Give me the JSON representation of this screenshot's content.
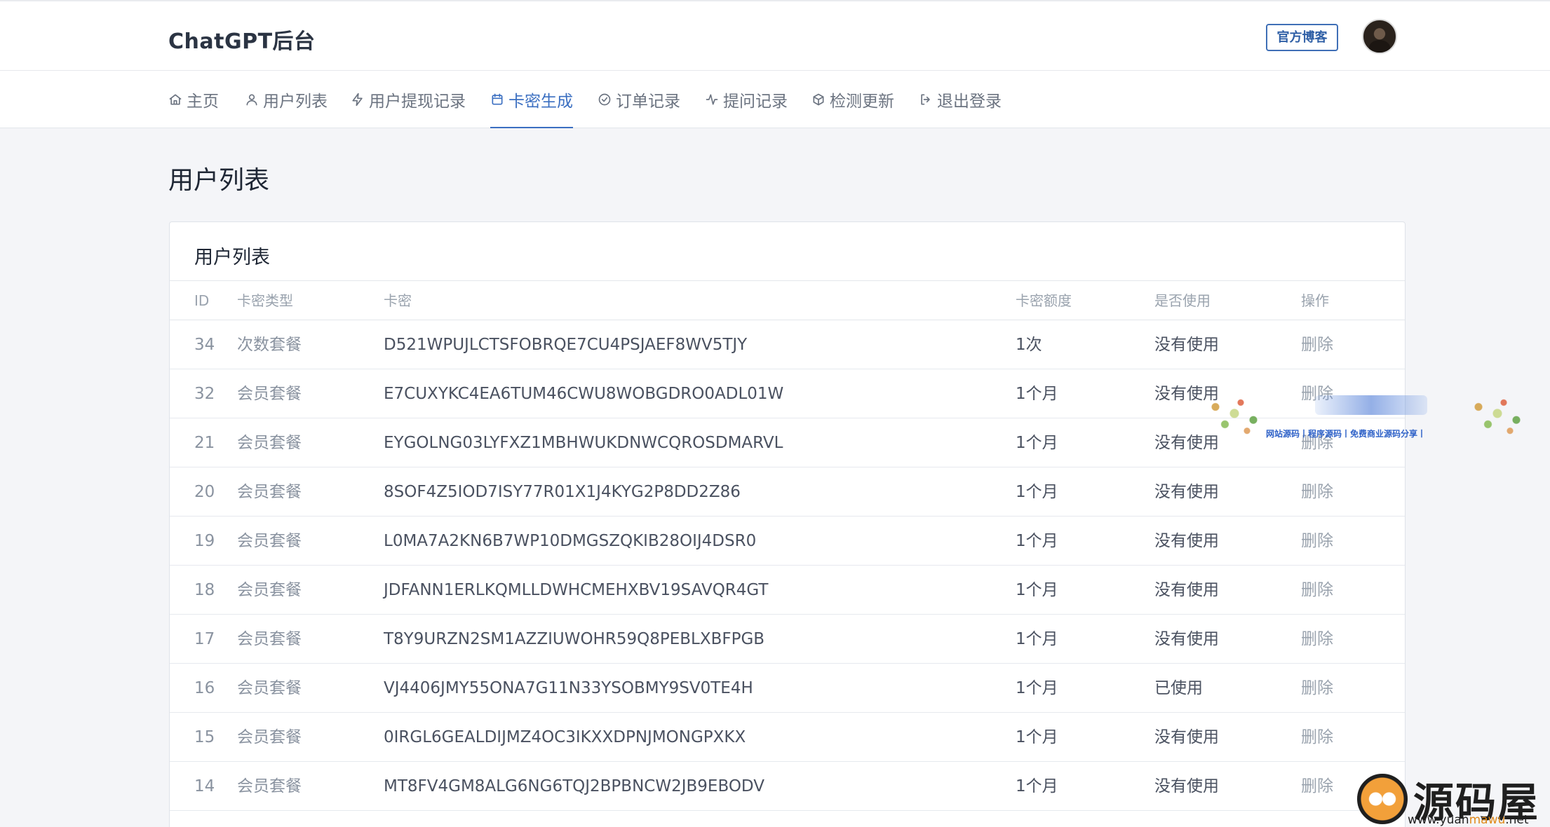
{
  "brand": "ChatGPT后台",
  "header": {
    "blog_label": "官方博客"
  },
  "nav": [
    {
      "label": "主页",
      "icon": "home-icon"
    },
    {
      "label": "用户列表",
      "icon": "user-icon"
    },
    {
      "label": "用户提现记录",
      "icon": "bolt-icon"
    },
    {
      "label": "卡密生成",
      "icon": "calendar-icon",
      "active": true
    },
    {
      "label": "订单记录",
      "icon": "check-circle-icon"
    },
    {
      "label": "提问记录",
      "icon": "activity-icon"
    },
    {
      "label": "检测更新",
      "icon": "package-icon"
    },
    {
      "label": "退出登录",
      "icon": "logout-icon"
    }
  ],
  "page_title": "用户列表",
  "card_title": "用户列表",
  "columns": [
    "ID",
    "卡密类型",
    "卡密",
    "卡密额度",
    "是否使用",
    "操作"
  ],
  "rows": [
    {
      "id": "34",
      "type": "次数套餐",
      "key": "D521WPUJLCTSFOBRQE7CU4PSJAEF8WV5TJY",
      "amount": "1次",
      "used": "没有使用",
      "op": "删除"
    },
    {
      "id": "32",
      "type": "会员套餐",
      "key": "E7CUXYKC4EA6TUM46CWU8WOBGDRO0ADL01W",
      "amount": "1个月",
      "used": "没有使用",
      "op": "删除"
    },
    {
      "id": "21",
      "type": "会员套餐",
      "key": "EYGOLNG03LYFXZ1MBHWUKDNWCQROSDMARVL",
      "amount": "1个月",
      "used": "没有使用",
      "op": "删除"
    },
    {
      "id": "20",
      "type": "会员套餐",
      "key": "8SOF4Z5IOD7ISY77R01X1J4KYG2P8DD2Z86",
      "amount": "1个月",
      "used": "没有使用",
      "op": "删除"
    },
    {
      "id": "19",
      "type": "会员套餐",
      "key": "L0MA7A2KN6B7WP10DMGSZQKIB28OIJ4DSR0",
      "amount": "1个月",
      "used": "没有使用",
      "op": "删除"
    },
    {
      "id": "18",
      "type": "会员套餐",
      "key": "JDFANN1ERLKQMLLDWHCMEHXBV19SAVQR4GT",
      "amount": "1个月",
      "used": "没有使用",
      "op": "删除"
    },
    {
      "id": "17",
      "type": "会员套餐",
      "key": "T8Y9URZN2SM1AZZIUWOHR59Q8PEBLXBFPGB",
      "amount": "1个月",
      "used": "没有使用",
      "op": "删除"
    },
    {
      "id": "16",
      "type": "会员套餐",
      "key": "VJ4406JMY55ONA7G11N33YSOBMY9SV0TE4H",
      "amount": "1个月",
      "used": "已使用",
      "op": "删除"
    },
    {
      "id": "15",
      "type": "会员套餐",
      "key": "0IRGL6GEALDIJMZ4OC3IKXXDPNJMONGPXKX",
      "amount": "1个月",
      "used": "没有使用",
      "op": "删除"
    },
    {
      "id": "14",
      "type": "会员套餐",
      "key": "MT8FV4GM8ALG6NG6TQJ2BPBNCW2JB9EBODV",
      "amount": "1个月",
      "used": "没有使用",
      "op": "删除"
    }
  ],
  "watermarks": {
    "banner_text": "网站源码丨程序源码丨免费商业源码分享丨",
    "logo_text": "源码屋",
    "logo_url_prefix": "www.yuan",
    "logo_url_mid": "mawu",
    "logo_url_suffix": ".net"
  },
  "colors": {
    "accent": "#3b6fc1",
    "brand_blog_border": "#3f6fb6",
    "muted_text": "#8a93a0",
    "background": "#f4f5f8"
  }
}
